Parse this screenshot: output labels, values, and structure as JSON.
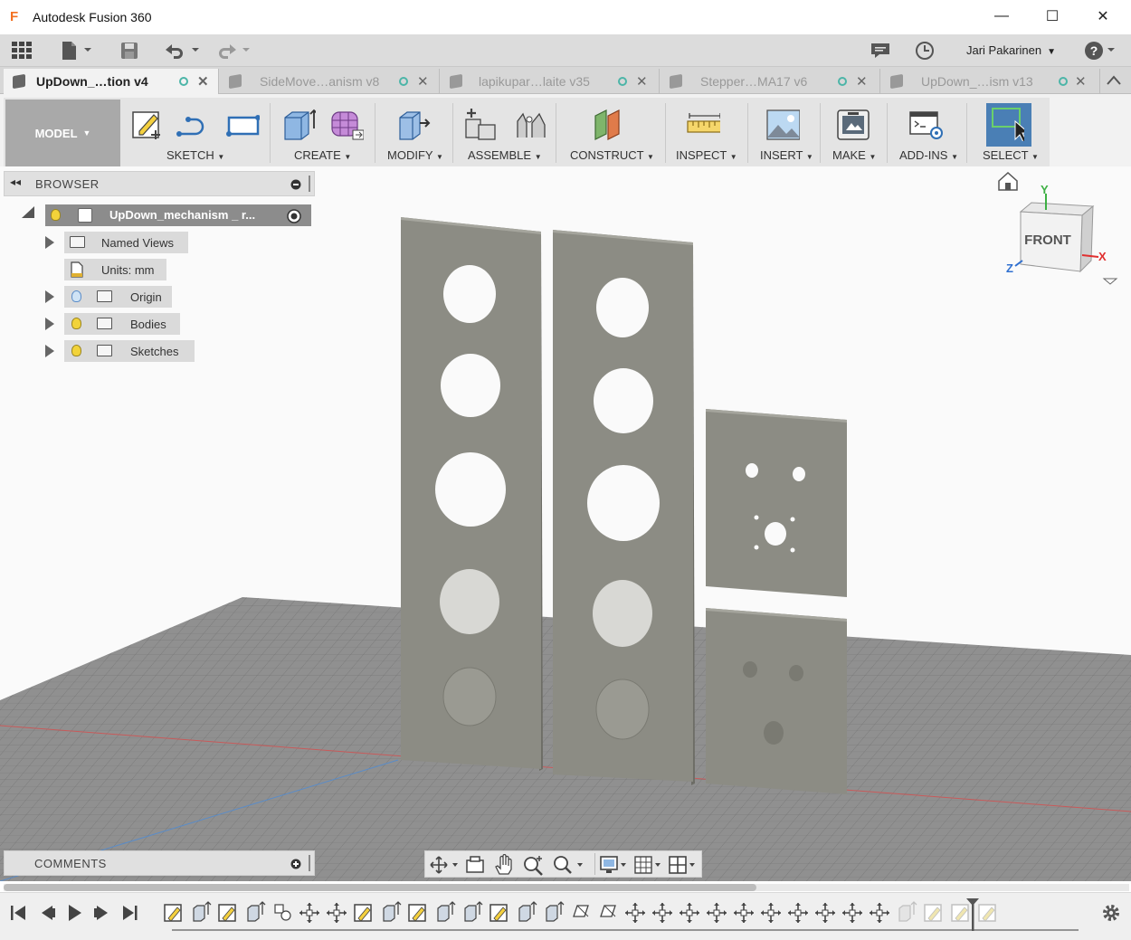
{
  "window": {
    "title": "Autodesk Fusion 360",
    "logo_letter": "F",
    "minimize_glyph": "—",
    "maximize_glyph": "☐",
    "close_glyph": "✕"
  },
  "appbar": {
    "user_name": "Jari Pakarinen",
    "icons": [
      "grid-icon",
      "file-icon",
      "save-icon",
      "undo-icon",
      "redo-icon",
      "comment-icon",
      "history-icon",
      "help-icon"
    ]
  },
  "tabs": [
    {
      "label": "UpDown_…tion v4",
      "active": true
    },
    {
      "label": "SideMove…anism v8",
      "active": false
    },
    {
      "label": "lapikupar…laite v35",
      "active": false
    },
    {
      "label": "Stepper…MA17 v6",
      "active": false
    },
    {
      "label": "UpDown_…ism v13",
      "active": false
    }
  ],
  "toolbar": {
    "workspace": "MODEL",
    "groups": [
      "SKETCH",
      "CREATE",
      "MODIFY",
      "ASSEMBLE",
      "CONSTRUCT",
      "INSPECT",
      "INSERT",
      "MAKE",
      "ADD-INS",
      "SELECT"
    ]
  },
  "browser": {
    "title": "BROWSER",
    "root": "UpDown_mechanism _ r...",
    "items": [
      {
        "label": "Named Views"
      },
      {
        "label": "Units: mm"
      },
      {
        "label": "Origin"
      },
      {
        "label": "Bodies"
      },
      {
        "label": "Sketches"
      }
    ]
  },
  "viewcube": {
    "face": "FRONT",
    "axis_y": "Y",
    "axis_x": "X",
    "axis_z": "Z"
  },
  "comments": {
    "title": "COMMENTS"
  },
  "colors": {
    "accent_active": "#4a7fb5",
    "part_face": "#8e8e86",
    "grid": "#8d8d8d",
    "tab_dot": "#4cb5a8"
  }
}
